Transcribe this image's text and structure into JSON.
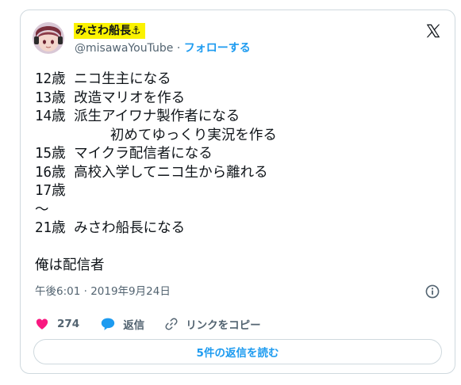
{
  "tweet": {
    "author": {
      "display_name": "みさわ船長⚓",
      "handle": "@misawaYouTube",
      "separator": "·",
      "follow_label": "フォローする"
    },
    "body": "12歳 ニコ生主になる\n13歳 改造マリオを作る\n14歳 派生アイワナ製作者になる\n         初めてゆっくり実況を作る\n15歳 マイクラ配信者になる\n16歳 高校入学してニコ生から離れる\n17歳\n〜\n21歳 みさわ船長になる\n\n俺は配信者",
    "timestamp": "午後6:01 · 2019年9月24日",
    "actions": {
      "like_count": "274",
      "reply_label": "返信",
      "copy_link_label": "リンクをコピー"
    },
    "read_replies_label": "5件の返信を読む"
  },
  "icons": {
    "logo": "x-logo-icon",
    "info": "info-icon",
    "like": "heart-icon",
    "reply": "reply-bubble-icon",
    "link": "link-icon"
  },
  "colors": {
    "accent": "#1d9bf0",
    "like": "#f91880",
    "name_highlight": "#fbf200",
    "secondary_text": "#536471",
    "border": "#cfd9de"
  }
}
